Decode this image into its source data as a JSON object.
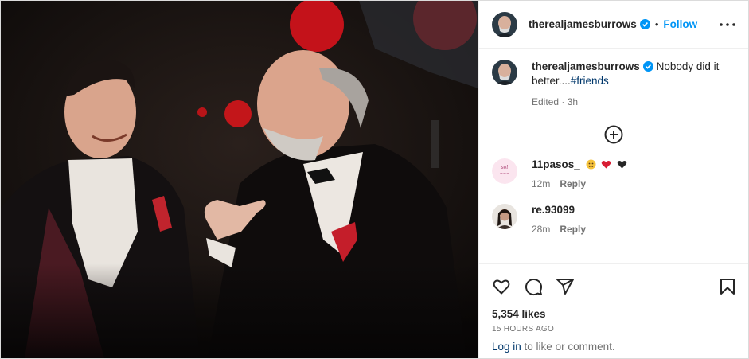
{
  "post": {
    "username": "therealjamesburrows",
    "follow_label": "Follow",
    "separator": "•",
    "caption_text": "Nobody did it better....",
    "caption_tag": "#friends",
    "caption_meta": "Edited · 3h",
    "likes": "5,354 likes",
    "time_ago": "15 HOURS AGO",
    "login_link": "Log in",
    "login_rest": " to like or comment."
  },
  "comments": [
    {
      "username": "11pasos_",
      "emoji": [
        "worried-face",
        "red-heart",
        "black-heart"
      ],
      "time": "12m",
      "reply_label": "Reply"
    },
    {
      "username": "re.93099",
      "time": "28m",
      "reply_label": "Reply"
    }
  ],
  "colors": {
    "accent": "#0095f6",
    "link": "#00376b",
    "secondary_text": "#737373",
    "border": "#efefef",
    "heart": "#e0245e"
  },
  "icons": [
    "verified-badge-icon",
    "more-options-icon",
    "add-comment-icon",
    "heart-icon",
    "comment-icon",
    "share-icon",
    "bookmark-icon"
  ]
}
